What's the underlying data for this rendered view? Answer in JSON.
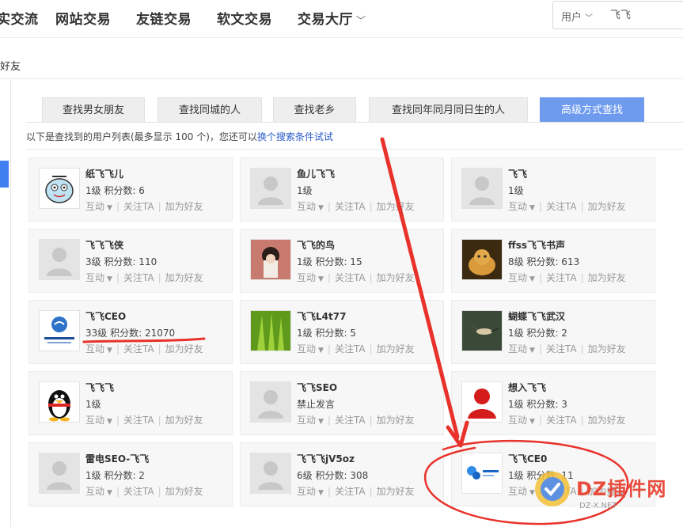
{
  "topnav": {
    "items": [
      "实交流",
      "网站交易",
      "友链交易",
      "软文交易",
      "交易大厅"
    ],
    "search_type": "用户",
    "search_value": "飞飞"
  },
  "crumb": "好友",
  "tabs": [
    "查找男女朋友",
    "查找同城的人",
    "查找老乡",
    "查找同年同月同日生的人",
    "高级方式查找"
  ],
  "notice": {
    "text": "以下是查找到的用户列表(最多显示 100 个)，您还可以",
    "link": "换个搜索条件试试"
  },
  "actions": {
    "interact": "互动",
    "follow": "关注TA",
    "add_friend": "加为好友"
  },
  "users": [
    {
      "name": "纸飞飞儿",
      "stats": "1级  积分数: 6"
    },
    {
      "name": "鱼儿飞飞",
      "stats": "1级"
    },
    {
      "name": "飞飞",
      "stats": "1级"
    },
    {
      "name": "飞飞飞侠",
      "stats": "3级  积分数: 110"
    },
    {
      "name": "飞飞的鸟",
      "stats": "1级  积分数: 15"
    },
    {
      "name": "ffss飞飞书声",
      "stats": "8级  积分数: 613"
    },
    {
      "name": "飞飞CEO",
      "stats": "33级  积分数: 21070"
    },
    {
      "name": "飞飞L4t77",
      "stats": "1级  积分数: 5"
    },
    {
      "name": "蝴蝶飞飞武汉",
      "stats": "1级  积分数: 2"
    },
    {
      "name": "飞飞飞",
      "stats": "1级"
    },
    {
      "name": "飞飞SEO",
      "stats": "禁止发言"
    },
    {
      "name": "想入飞飞",
      "stats": "1级  积分数: 3"
    },
    {
      "name": "雷电SEO-飞飞",
      "stats": "1级  积分数: 2"
    },
    {
      "name": "飞飞飞jV5oz",
      "stats": "6级  积分数: 308"
    },
    {
      "name": "飞飞CE0",
      "stats": "1级  积分数: 11"
    }
  ],
  "watermark": {
    "title": "DZ插件网",
    "url": "DZ-X.NET"
  },
  "colors": {
    "accent": "#6f9bef",
    "link": "#2b5cc8",
    "annotation": "#e8322b"
  }
}
